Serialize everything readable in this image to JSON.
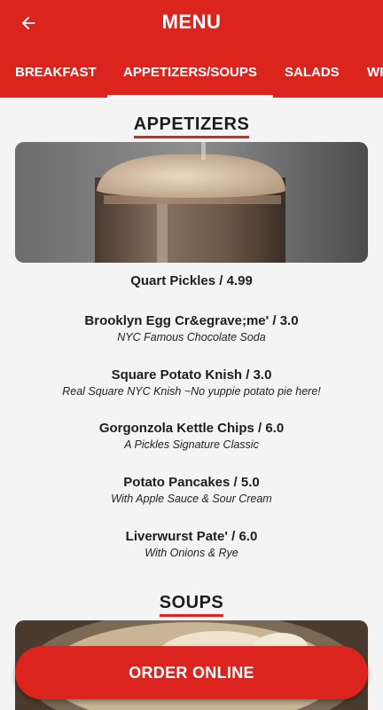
{
  "app": {
    "title": "MENU",
    "brand_color": "#dc241f"
  },
  "tabs": [
    {
      "label": "BREAKFAST"
    },
    {
      "label": "APPETIZERS/SOUPS",
      "active": true
    },
    {
      "label": "SALADS"
    },
    {
      "label": "WRAPS"
    }
  ],
  "sections": {
    "appetizers": {
      "title": "APPETIZERS",
      "items": [
        {
          "name": "Quart Pickles / 4.99",
          "desc": ""
        },
        {
          "name": "Brooklyn Egg Cr&egrave;me' / 3.0",
          "desc": "NYC Famous Chocolate Soda"
        },
        {
          "name": "Square Potato Knish / 3.0",
          "desc": "Real Square NYC Knish ~No yuppie potato pie here!"
        },
        {
          "name": "Gorgonzola Kettle Chips / 6.0",
          "desc": "A Pickles Signature Classic"
        },
        {
          "name": "Potato Pancakes / 5.0",
          "desc": "With Apple Sauce & Sour Cream"
        },
        {
          "name": "Liverwurst Pate' / 6.0",
          "desc": "With Onions & Rye"
        }
      ]
    },
    "soups": {
      "title": "SOUPS"
    }
  },
  "order_button": {
    "label": "ORDER ONLINE"
  },
  "icons": {
    "back": "arrow-left-icon"
  }
}
